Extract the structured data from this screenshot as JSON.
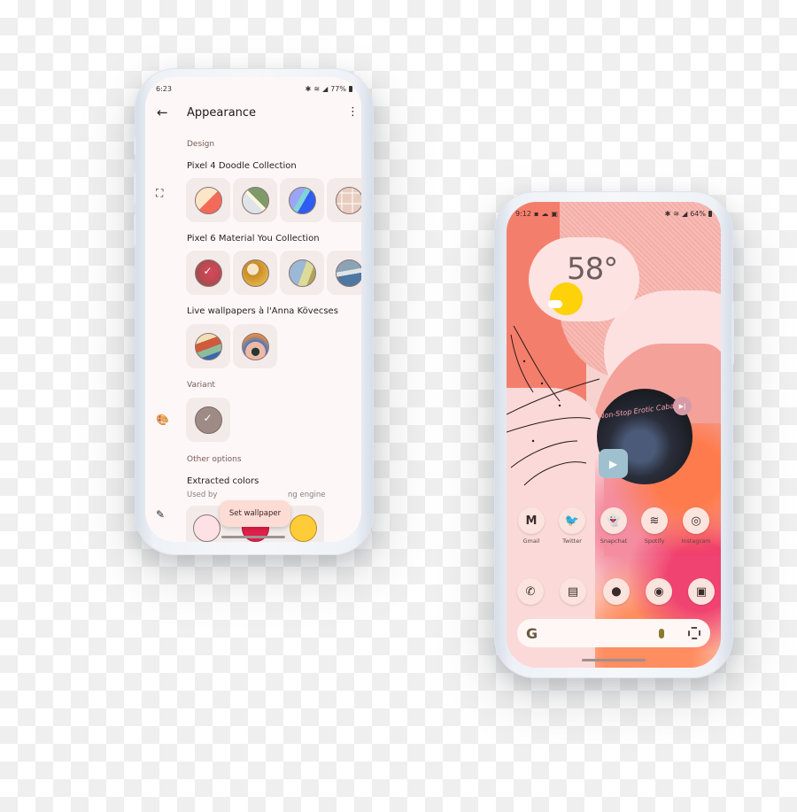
{
  "left_phone": {
    "status_bar": {
      "time": "6:23",
      "battery": "77%"
    },
    "top_bar": {
      "back_icon": "arrow-left",
      "title": "Appearance",
      "more_icon": "more-vert"
    },
    "sections": {
      "design": {
        "heading": "Design",
        "collections": [
          {
            "title": "Pixel 4 Doodle Collection",
            "count_visible": 4
          },
          {
            "title": "Pixel 6 Material You Collection",
            "count_visible": 4,
            "selected_index": 0
          },
          {
            "title": "Live wallpapers à l'Anna Kövecses",
            "count_visible": 2
          }
        ]
      },
      "variant": {
        "heading": "Variant",
        "selected": true
      },
      "other_options": {
        "heading": "Other options",
        "extracted_colors": {
          "title": "Extracted colors",
          "subtitle_left": "Used by",
          "subtitle_right": "ng engine",
          "colors": [
            "#fde1e4",
            "#e0204a",
            "#fecc38"
          ]
        }
      }
    },
    "rail_icons": [
      "wallpaper-icon",
      "palette-icon",
      "eyedropper-icon"
    ],
    "fab": {
      "label": "Set wallpaper"
    }
  },
  "right_phone": {
    "status_bar": {
      "time": "9:12",
      "battery": "64%"
    },
    "weather": {
      "temperature": "58°",
      "condition_icon": "sun-cloud"
    },
    "media": {
      "album_text": "Non-Stop Erotic Cabaret",
      "play_icon": "play",
      "skip_icon": "skip-next"
    },
    "apps_row1": [
      {
        "label": "Gmail",
        "glyph": "M"
      },
      {
        "label": "Twitter",
        "glyph": "🐦"
      },
      {
        "label": "Snapchat",
        "glyph": "👻"
      },
      {
        "label": "Spotify",
        "glyph": "≋"
      },
      {
        "label": "Instagram",
        "glyph": "◎"
      }
    ],
    "dock": [
      {
        "name": "phone",
        "glyph": "✆"
      },
      {
        "name": "messages",
        "glyph": "▤"
      },
      {
        "name": "maps",
        "glyph": "⬤"
      },
      {
        "name": "chrome",
        "glyph": "◉"
      },
      {
        "name": "camera",
        "glyph": "▣"
      }
    ],
    "search_bar": {
      "g_logo": "G",
      "mic_icon": "mic",
      "lens_icon": "lens"
    }
  },
  "colors": {
    "accent_salmon": "#f47e6c",
    "pink_light": "#fde2e2",
    "screen_bg": "#fdf8f7",
    "fab_bg": "#fcdcd5"
  }
}
